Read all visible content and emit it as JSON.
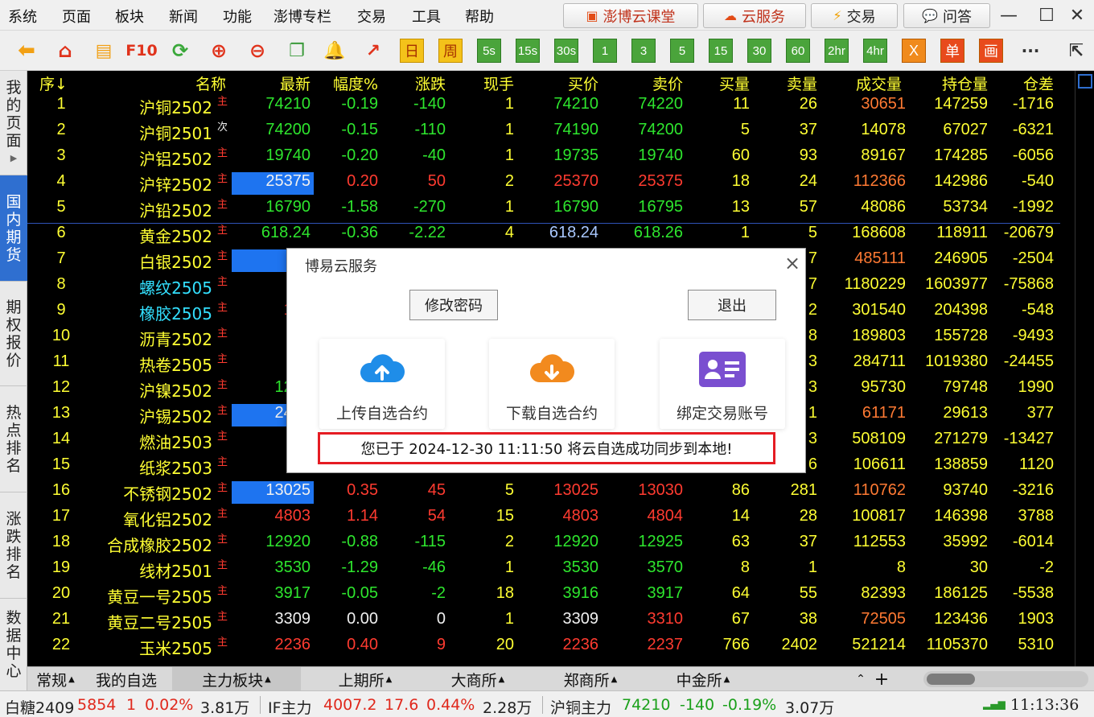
{
  "menu": {
    "items": [
      "系统",
      "页面",
      "板块",
      "新闻",
      "功能",
      "澎博专栏",
      "交易",
      "工具",
      "帮助"
    ],
    "buttons": [
      {
        "label": "澎博云课堂",
        "icon": "classroom-icon"
      },
      {
        "label": "云服务",
        "icon": "cloud-service-icon"
      },
      {
        "label": "交易",
        "icon": "lightning-icon"
      },
      {
        "label": "问答",
        "icon": "chat-icon"
      }
    ]
  },
  "toolbar": {
    "icons": [
      "back-arrow-icon",
      "home-icon",
      "notes-icon",
      "f10-icon",
      "refresh-icon",
      "zoom-in-icon",
      "zoom-out-icon",
      "window-overlap-icon",
      "bell-icon",
      "chart-arrow-icon"
    ],
    "f10_label": "F10",
    "periods": [
      "日",
      "周",
      "5s",
      "15s",
      "30s",
      "1",
      "3",
      "5",
      "15",
      "30",
      "60",
      "2hr",
      "4hr"
    ],
    "x_label": "X",
    "dan_label": "单",
    "hua_label": "画",
    "more_label": "···"
  },
  "sidebar": {
    "tabs": [
      {
        "label": "我的页面",
        "active": false
      },
      {
        "label": "国内期货",
        "active": true
      },
      {
        "label": "期权报价",
        "active": false
      },
      {
        "label": "热点排名",
        "active": false
      },
      {
        "label": "涨跌排名",
        "active": false
      },
      {
        "label": "数据中心",
        "active": false
      }
    ]
  },
  "table": {
    "headers": [
      "序↓",
      "名称",
      "最新",
      "幅度%",
      "涨跌",
      "现手",
      "买价",
      "卖价",
      "买量",
      "卖量",
      "成交量",
      "持仓量",
      "仓差"
    ],
    "rows": [
      {
        "no": "1",
        "name": "沪铜2502",
        "tag": "主",
        "last": "74210",
        "pct": "-0.19",
        "chg": "-140",
        "hand": "1",
        "bid": "74210",
        "ask": "74220",
        "bidv": "11",
        "askv": "26",
        "vol": "30651",
        "oi": "147259",
        "oid": "-1716"
      },
      {
        "no": "2",
        "name": "沪铜2501",
        "tag": "次",
        "last": "74200",
        "pct": "-0.15",
        "chg": "-110",
        "hand": "1",
        "bid": "74190",
        "ask": "74200",
        "bidv": "5",
        "askv": "37",
        "vol": "14078",
        "oi": "67027",
        "oid": "-6321"
      },
      {
        "no": "3",
        "name": "沪铝2502",
        "tag": "主",
        "last": "19740",
        "pct": "-0.20",
        "chg": "-40",
        "hand": "1",
        "bid": "19735",
        "ask": "19740",
        "bidv": "60",
        "askv": "93",
        "vol": "89167",
        "oi": "174285",
        "oid": "-6056"
      },
      {
        "no": "4",
        "name": "沪锌2502",
        "tag": "主",
        "last": "25375",
        "pct": "0.20",
        "chg": "50",
        "hand": "2",
        "bid": "25370",
        "ask": "25375",
        "bidv": "18",
        "askv": "24",
        "vol": "112366",
        "oi": "142986",
        "oid": "-540"
      },
      {
        "no": "5",
        "name": "沪铅2502",
        "tag": "主",
        "last": "16790",
        "pct": "-1.58",
        "chg": "-270",
        "hand": "1",
        "bid": "16790",
        "ask": "16795",
        "bidv": "13",
        "askv": "57",
        "vol": "48086",
        "oi": "53734",
        "oid": "-1992"
      },
      {
        "no": "6",
        "name": "黄金2502",
        "tag": "主",
        "last": "618.24",
        "pct": "-0.36",
        "chg": "-2.22",
        "hand": "4",
        "bid": "618.24",
        "ask": "618.26",
        "bidv": "1",
        "askv": "5",
        "vol": "168608",
        "oi": "118911",
        "oid": "-20679"
      },
      {
        "no": "7",
        "name": "白银2502",
        "tag": "主",
        "last": "75",
        "pct": "",
        "chg": "",
        "hand": "",
        "bid": "",
        "ask": "",
        "bidv": "",
        "askv": "7",
        "vol": "485111",
        "oi": "246905",
        "oid": "-2504"
      },
      {
        "no": "8",
        "name": "螺纹2505",
        "tag": "主",
        "last": "33",
        "pct": "",
        "chg": "",
        "hand": "",
        "bid": "",
        "ask": "",
        "bidv": "",
        "askv": "7",
        "vol": "1180229",
        "oi": "1603977",
        "oid": "-75868"
      },
      {
        "no": "9",
        "name": "橡胶2505",
        "tag": "主",
        "last": "177",
        "pct": "",
        "chg": "",
        "hand": "",
        "bid": "",
        "ask": "",
        "bidv": "",
        "askv": "2",
        "vol": "301540",
        "oi": "204398",
        "oid": "-548"
      },
      {
        "no": "10",
        "name": "沥青2502",
        "tag": "主",
        "last": "36",
        "pct": "",
        "chg": "",
        "hand": "",
        "bid": "",
        "ask": "",
        "bidv": "",
        "askv": "8",
        "vol": "189803",
        "oi": "155728",
        "oid": "-9493"
      },
      {
        "no": "11",
        "name": "热卷2505",
        "tag": "主",
        "last": "34",
        "pct": "",
        "chg": "",
        "hand": "",
        "bid": "",
        "ask": "",
        "bidv": "",
        "askv": "3",
        "vol": "284711",
        "oi": "1019380",
        "oid": "-24455"
      },
      {
        "no": "12",
        "name": "沪镍2502",
        "tag": "主",
        "last": "1249",
        "pct": "",
        "chg": "",
        "hand": "",
        "bid": "",
        "ask": "",
        "bidv": "",
        "askv": "3",
        "vol": "95730",
        "oi": "79748",
        "oid": "1990"
      },
      {
        "no": "13",
        "name": "沪锡2502",
        "tag": "主",
        "last": "2470",
        "pct": "",
        "chg": "",
        "hand": "",
        "bid": "",
        "ask": "",
        "bidv": "",
        "askv": "1",
        "vol": "61171",
        "oi": "29613",
        "oid": "377"
      },
      {
        "no": "14",
        "name": "燃油2503",
        "tag": "主",
        "last": "32",
        "pct": "",
        "chg": "",
        "hand": "",
        "bid": "",
        "ask": "",
        "bidv": "",
        "askv": "3",
        "vol": "508109",
        "oi": "271279",
        "oid": "-13427"
      },
      {
        "no": "15",
        "name": "纸浆2503",
        "tag": "主",
        "last": "59",
        "pct": "",
        "chg": "",
        "hand": "",
        "bid": "",
        "ask": "",
        "bidv": "",
        "askv": "6",
        "vol": "106611",
        "oi": "138859",
        "oid": "1120"
      },
      {
        "no": "16",
        "name": "不锈钢2502",
        "tag": "主",
        "last": "13025",
        "pct": "0.35",
        "chg": "45",
        "hand": "5",
        "bid": "13025",
        "ask": "13030",
        "bidv": "86",
        "askv": "281",
        "vol": "110762",
        "oi": "93740",
        "oid": "-3216"
      },
      {
        "no": "17",
        "name": "氧化铝2502",
        "tag": "主",
        "last": "4803",
        "pct": "1.14",
        "chg": "54",
        "hand": "15",
        "bid": "4803",
        "ask": "4804",
        "bidv": "14",
        "askv": "28",
        "vol": "100817",
        "oi": "146398",
        "oid": "3788"
      },
      {
        "no": "18",
        "name": "合成橡胶2502",
        "tag": "主",
        "last": "12920",
        "pct": "-0.88",
        "chg": "-115",
        "hand": "2",
        "bid": "12920",
        "ask": "12925",
        "bidv": "63",
        "askv": "37",
        "vol": "112553",
        "oi": "35992",
        "oid": "-6014"
      },
      {
        "no": "19",
        "name": "线材2501",
        "tag": "主",
        "last": "3530",
        "pct": "-1.29",
        "chg": "-46",
        "hand": "1",
        "bid": "3530",
        "ask": "3570",
        "bidv": "8",
        "askv": "1",
        "vol": "8",
        "oi": "30",
        "oid": "-2"
      },
      {
        "no": "20",
        "name": "黄豆一号2505",
        "tag": "主",
        "last": "3917",
        "pct": "-0.05",
        "chg": "-2",
        "hand": "18",
        "bid": "3916",
        "ask": "3917",
        "bidv": "64",
        "askv": "55",
        "vol": "82393",
        "oi": "186125",
        "oid": "-5538"
      },
      {
        "no": "21",
        "name": "黄豆二号2505",
        "tag": "主",
        "last": "3309",
        "pct": "0.00",
        "chg": "0",
        "hand": "1",
        "bid": "3309",
        "ask": "3310",
        "bidv": "67",
        "askv": "38",
        "vol": "72505",
        "oi": "123436",
        "oid": "1903"
      },
      {
        "no": "22",
        "name": "玉米2505",
        "tag": "主",
        "last": "2236",
        "pct": "0.40",
        "chg": "9",
        "hand": "20",
        "bid": "2236",
        "ask": "2237",
        "bidv": "766",
        "askv": "2402",
        "vol": "521214",
        "oi": "1105370",
        "oid": "5310"
      }
    ],
    "colors": {
      "rows": [
        {
          "name": "#ffff33",
          "last": "#2ee62e",
          "pct": "#2ee62e",
          "chg": "#2ee62e",
          "bid": "#2ee62e",
          "ask": "#2ee62e",
          "vol": "#ff7a33",
          "oid": "#ffff33"
        },
        {
          "name": "#ffff33",
          "last": "#2ee62e",
          "pct": "#2ee62e",
          "chg": "#2ee62e",
          "bid": "#2ee62e",
          "ask": "#2ee62e",
          "vol": "#ffff33",
          "oid": "#ffff33"
        },
        {
          "name": "#ffff33",
          "last": "#2ee62e",
          "pct": "#2ee62e",
          "chg": "#2ee62e",
          "bid": "#2ee62e",
          "ask": "#2ee62e",
          "vol": "#ffff33",
          "oid": "#ffff33"
        },
        {
          "name": "#ffff33",
          "last": "#f0f0f0",
          "pct": "#ff3b30",
          "chg": "#ff3b30",
          "bid": "#ff3b30",
          "ask": "#ff3b30",
          "vol": "#ff7a33",
          "oid": "#ffff33"
        },
        {
          "name": "#ffff33",
          "last": "#2ee62e",
          "pct": "#2ee62e",
          "chg": "#2ee62e",
          "bid": "#2ee62e",
          "ask": "#2ee62e",
          "vol": "#ffff33",
          "oid": "#ffff33"
        },
        {
          "name": "#ffff33",
          "last": "#2ee62e",
          "pct": "#2ee62e",
          "chg": "#2ee62e",
          "bid": "#a9c8ff",
          "ask": "#2ee62e",
          "vol": "#ffff33",
          "oid": "#ffff33"
        },
        {
          "name": "#ffff33",
          "last": "#f0f0f0",
          "pct": "#ff3b30",
          "chg": "#ff3b30",
          "bid": "#ff3b30",
          "ask": "#ff3b30",
          "vol": "#ff7a33",
          "oid": "#ffff33"
        },
        {
          "name": "#33e0ff",
          "last": "#ff3b30",
          "pct": "#ff3b30",
          "chg": "#ff3b30",
          "bid": "#ff3b30",
          "ask": "#ff3b30",
          "vol": "#ffff33",
          "oid": "#ffff33"
        },
        {
          "name": "#33e0ff",
          "last": "#ff3b30",
          "pct": "#ff3b30",
          "chg": "#ff3b30",
          "bid": "#ff3b30",
          "ask": "#ff3b30",
          "vol": "#ffff33",
          "oid": "#ffff33"
        },
        {
          "name": "#ffff33",
          "last": "#ff3b30",
          "pct": "#ff3b30",
          "chg": "#ff3b30",
          "bid": "#ff3b30",
          "ask": "#ff3b30",
          "vol": "#ffff33",
          "oid": "#ffff33"
        },
        {
          "name": "#ffff33",
          "last": "#ff3b30",
          "pct": "#ff3b30",
          "chg": "#ff3b30",
          "bid": "#ff3b30",
          "ask": "#ff3b30",
          "vol": "#ffff33",
          "oid": "#ffff33"
        },
        {
          "name": "#ffff33",
          "last": "#2ee62e",
          "pct": "#2ee62e",
          "chg": "#2ee62e",
          "bid": "#2ee62e",
          "ask": "#2ee62e",
          "vol": "#ffff33",
          "oid": "#ffff33"
        },
        {
          "name": "#ffff33",
          "last": "#f0f0f0",
          "pct": "#ff3b30",
          "chg": "#ff3b30",
          "bid": "#ff3b30",
          "ask": "#ff3b30",
          "vol": "#ff7a33",
          "oid": "#ffff33"
        },
        {
          "name": "#ffff33",
          "last": "#2ee62e",
          "pct": "#2ee62e",
          "chg": "#2ee62e",
          "bid": "#2ee62e",
          "ask": "#2ee62e",
          "vol": "#ffff33",
          "oid": "#ffff33"
        },
        {
          "name": "#ffff33",
          "last": "#ff3b30",
          "pct": "#ff3b30",
          "chg": "#ff3b30",
          "bid": "#ff3b30",
          "ask": "#ff3b30",
          "vol": "#ffff33",
          "oid": "#ffff33"
        },
        {
          "name": "#ffff33",
          "last": "#f0f0f0",
          "pct": "#ff3b30",
          "chg": "#ff3b30",
          "bid": "#ff3b30",
          "ask": "#ff3b30",
          "vol": "#ff7a33",
          "oid": "#ffff33"
        },
        {
          "name": "#ffff33",
          "last": "#ff3b30",
          "pct": "#ff3b30",
          "chg": "#ff3b30",
          "bid": "#ff3b30",
          "ask": "#ff3b30",
          "vol": "#ffff33",
          "oid": "#ffff33"
        },
        {
          "name": "#ffff33",
          "last": "#2ee62e",
          "pct": "#2ee62e",
          "chg": "#2ee62e",
          "bid": "#2ee62e",
          "ask": "#2ee62e",
          "vol": "#ffff33",
          "oid": "#ffff33"
        },
        {
          "name": "#ffff33",
          "last": "#2ee62e",
          "pct": "#2ee62e",
          "chg": "#2ee62e",
          "bid": "#2ee62e",
          "ask": "#2ee62e",
          "vol": "#ffff33",
          "oid": "#ffff33"
        },
        {
          "name": "#ffff33",
          "last": "#2ee62e",
          "pct": "#2ee62e",
          "chg": "#2ee62e",
          "bid": "#2ee62e",
          "ask": "#2ee62e",
          "vol": "#ffff33",
          "oid": "#ffff33"
        },
        {
          "name": "#ffff33",
          "last": "#f0f0f0",
          "pct": "#f0f0f0",
          "chg": "#f0f0f0",
          "bid": "#f0f0f0",
          "ask": "#ff3b30",
          "vol": "#ff7a33",
          "oid": "#ffff33"
        },
        {
          "name": "#ffff33",
          "last": "#ff3b30",
          "pct": "#ff3b30",
          "chg": "#ff3b30",
          "bid": "#ff3b30",
          "ask": "#ff3b30",
          "vol": "#ffff33",
          "oid": "#ffff33"
        }
      ],
      "highlight_rows": [
        "4",
        "7",
        "13",
        "16"
      ]
    }
  },
  "bottom_tabs": [
    {
      "label": "常规",
      "active": false,
      "arrow": true
    },
    {
      "label": "我的自选",
      "active": false,
      "arrow": false
    },
    {
      "label": "主力板块",
      "active": true,
      "arrow": true
    },
    {
      "label": "上期所",
      "active": false,
      "arrow": true
    },
    {
      "label": "大商所",
      "active": false,
      "arrow": true
    },
    {
      "label": "郑商所",
      "active": false,
      "arrow": true
    },
    {
      "label": "中金所",
      "active": false,
      "arrow": true
    }
  ],
  "status_bar": {
    "items": [
      {
        "name": "白糖2409",
        "price": "5854",
        "chg": "1",
        "pct": "0.02%",
        "amount": "3.81万"
      },
      {
        "name": "IF主力",
        "price": "4007.2",
        "chg": "17.6",
        "pct": "0.44%",
        "amount": "2.28万"
      },
      {
        "name": "沪铜主力",
        "price": "74210",
        "chg": "-140",
        "pct": "-0.19%",
        "amount": "3.07万"
      }
    ],
    "time": "11:13:36"
  },
  "dialog": {
    "title": "博易云服务",
    "change_password": "修改密码",
    "logout": "退出",
    "cards": [
      {
        "label": "上传自选合约",
        "icon": "cloud-upload-icon",
        "color": "#1f8de8"
      },
      {
        "label": "下载自选合约",
        "icon": "cloud-download-icon",
        "color": "#f28a1e"
      },
      {
        "label": "绑定交易账号",
        "icon": "id-card-icon",
        "color": "#7a4fd0"
      }
    ],
    "status": "您已于 2024-12-30 11:11:50 将云自选成功同步到本地!"
  }
}
